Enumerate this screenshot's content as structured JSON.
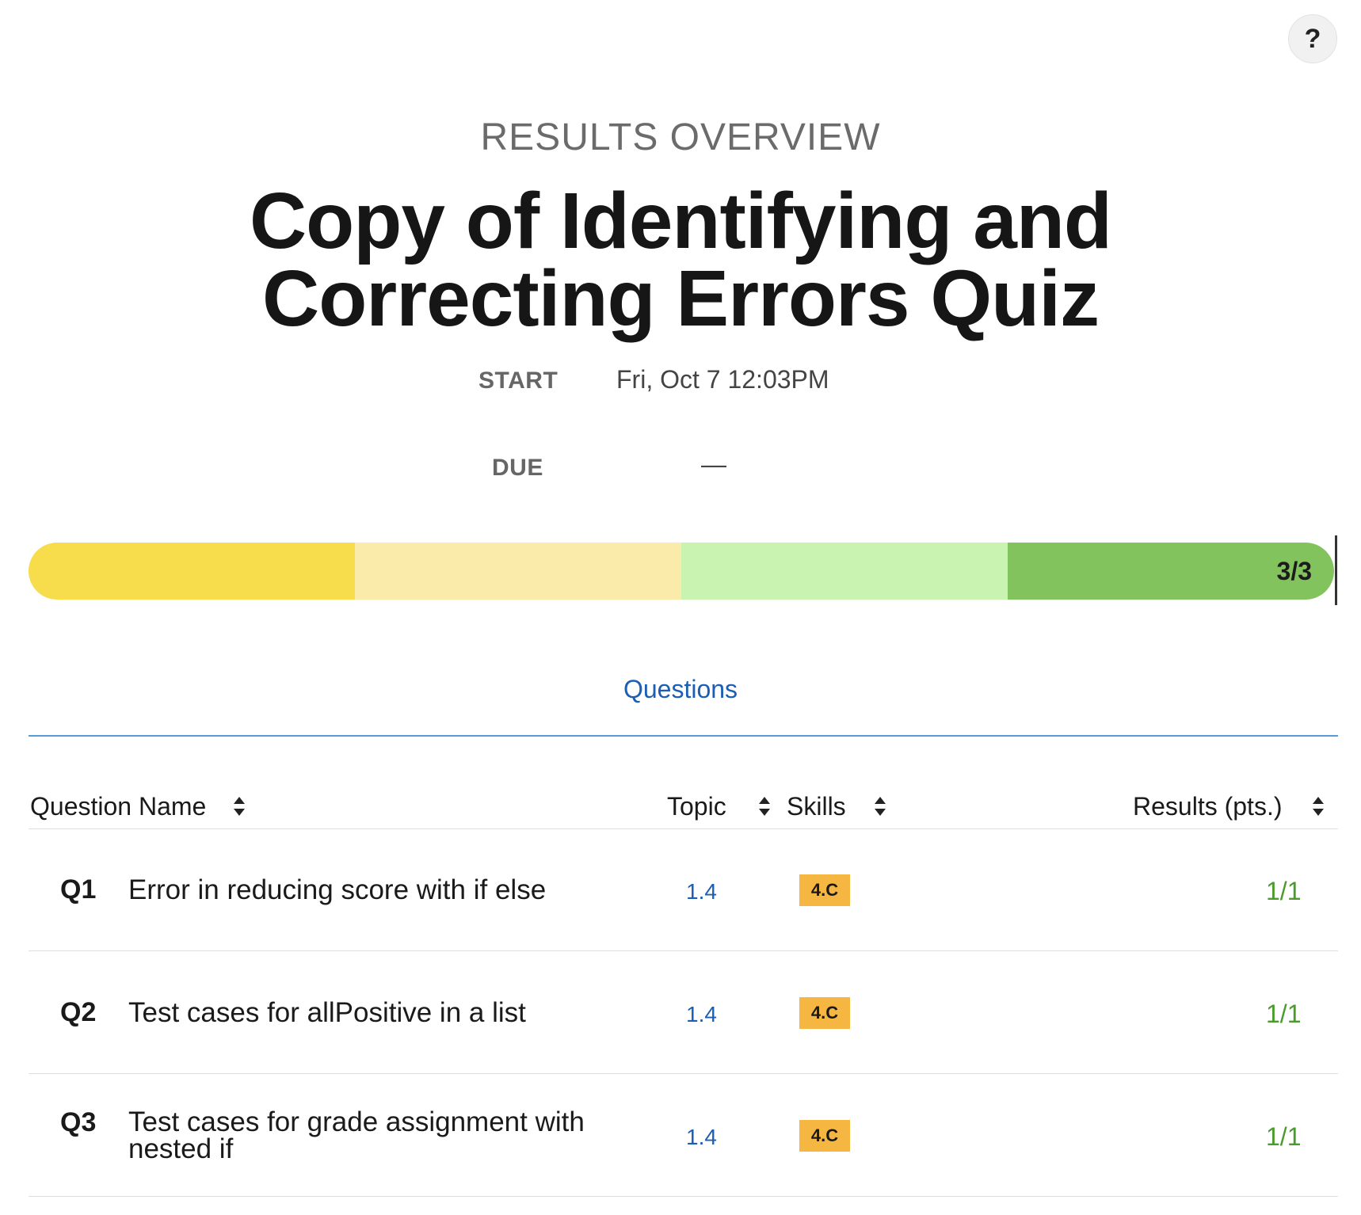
{
  "help_label": "?",
  "header": {
    "overline": "RESULTS OVERVIEW",
    "title": "Copy of Identifying and Correcting Errors Quiz"
  },
  "meta": {
    "start_label": "START",
    "start_value": "Fri, Oct 7 12:03PM",
    "due_label": "DUE",
    "due_value": "—"
  },
  "score": {
    "label": "3/3",
    "earned": 3,
    "total": 3,
    "segment_colors": [
      "#f7dc4b",
      "#fbebaa",
      "#c9f3b0",
      "#82c35e"
    ]
  },
  "tabs": {
    "questions": "Questions"
  },
  "table": {
    "headers": {
      "name": "Question Name",
      "topic": "Topic",
      "skills": "Skills",
      "results": "Results (pts.)"
    },
    "rows": [
      {
        "num": "Q1",
        "name": "Error in reducing score with if else",
        "topic": "1.4",
        "skill": "4.C",
        "result": "1/1"
      },
      {
        "num": "Q2",
        "name": "Test cases for allPositive in a list",
        "topic": "1.4",
        "skill": "4.C",
        "result": "1/1"
      },
      {
        "num": "Q3",
        "name": "Test cases for grade assignment with nested if",
        "topic": "1.4",
        "skill": "4.C",
        "result": "1/1"
      }
    ]
  },
  "colors": {
    "link_blue": "#1a5eb5",
    "result_green": "#4a9a2c",
    "skill_badge": "#f5b642"
  }
}
